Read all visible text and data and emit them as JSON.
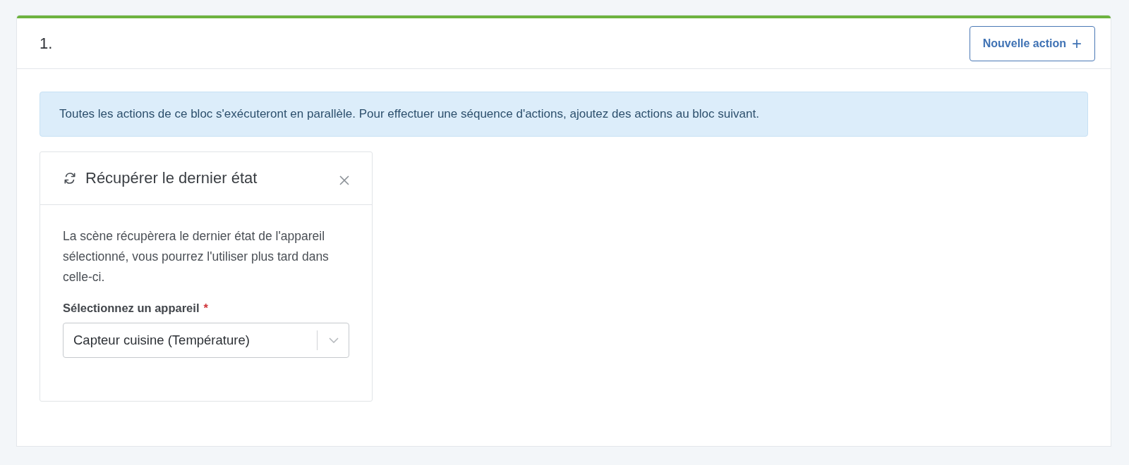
{
  "block": {
    "title": "1.",
    "add_button": {
      "label": "Nouvelle action",
      "icon": "+"
    },
    "info": "Toutes les actions de ce bloc s'exécuteront en parallèle. Pour effectuer une séquence d'actions, ajoutez des actions au bloc suivant.",
    "actions": [
      {
        "kind": "refresh",
        "title": "Récupérer le dernier état",
        "description": "La scène récupèrera le dernier état de l'appareil sélectionné, vous pourrez l'utiliser plus tard dans celle-ci.",
        "field": {
          "label": "Sélectionnez un appareil",
          "required_mark": "*",
          "value": "Capteur cuisine (Température)"
        }
      }
    ]
  }
}
